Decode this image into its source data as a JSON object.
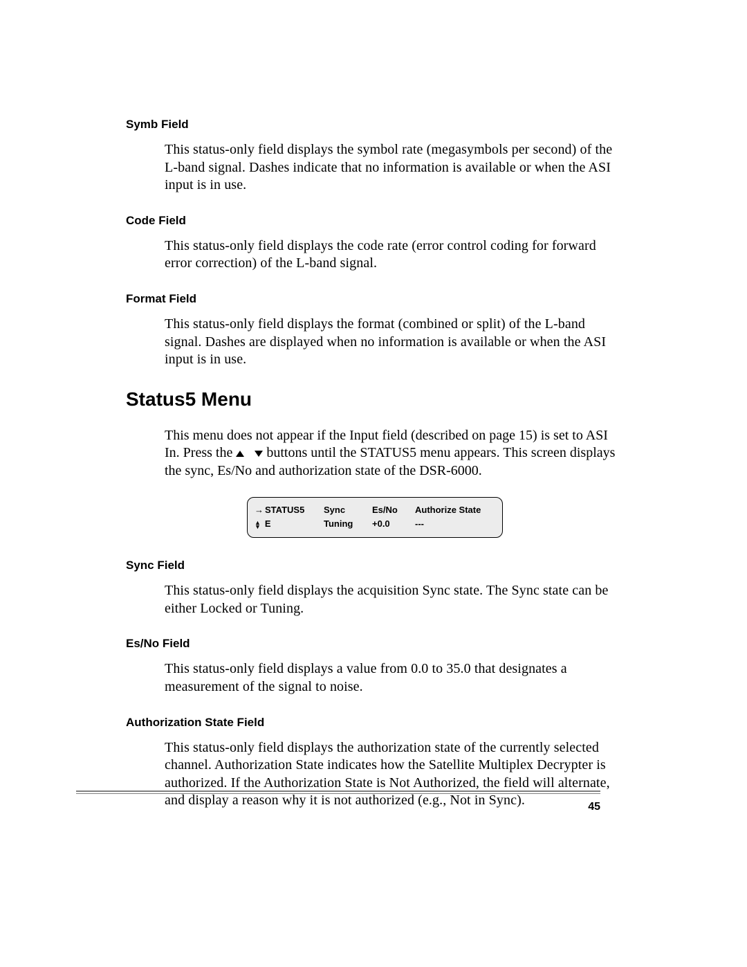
{
  "fields": {
    "symb": {
      "heading": "Symb Field",
      "body": "This status-only field displays the symbol rate (megasymbols per second) of the L-band signal. Dashes indicate that no information is available or when the ASI input is in use."
    },
    "code": {
      "heading": "Code Field",
      "body": "This status-only field displays the code rate (error control coding for forward error correction) of the L-band signal."
    },
    "format": {
      "heading": "Format Field",
      "body": "This status-only field displays the format (combined or split) of the L-band signal. Dashes are displayed when no information is available or when the ASI input is in use."
    },
    "sync": {
      "heading": "Sync Field",
      "body": "This status-only field displays the acquisition Sync state. The Sync state can be either Locked or Tuning."
    },
    "esno": {
      "heading": "Es/No Field",
      "body": "This status-only field displays a value from 0.0 to 35.0 that designates a measurement of the signal to noise."
    },
    "auth": {
      "heading": "Authorization State Field",
      "body": "This status-only field displays the authorization state of the currently selected channel. Authorization State indicates how the Satellite Multiplex Decrypter is authorized. If the Authorization State is Not Authorized, the field will alternate, and display a reason why it is not authorized (e.g., Not in Sync)."
    }
  },
  "section": {
    "heading": "Status5 Menu",
    "intro_a": "This menu does not appear if the Input field (described on page 15) is set to ASI In. Press the ",
    "intro_b": " buttons until the STATUS5 menu appears. This screen displays the sync, Es/No and authorization state of the DSR-6000."
  },
  "lcd": {
    "row1": {
      "c1": "STATUS5",
      "c2": "Sync",
      "c3": "Es/No",
      "c4": "Authorize State"
    },
    "row2": {
      "c1": "E",
      "c2": "Tuning",
      "c3": "+0.0",
      "c4": "---"
    }
  },
  "page_number": "45"
}
